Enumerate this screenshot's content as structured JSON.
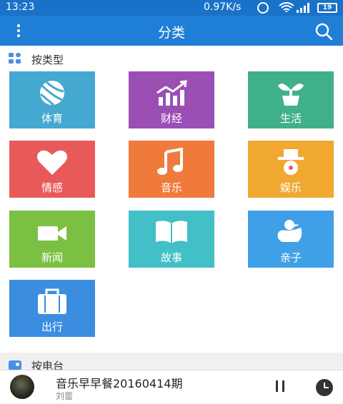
{
  "status_bar": {
    "time": "13:23",
    "net_speed": "0.97K/s",
    "battery": "19"
  },
  "app_bar": {
    "title": "分类",
    "menu_icon": "more-vertical-icon",
    "search_icon": "search-icon"
  },
  "by_type": {
    "label": "按类型",
    "categories": [
      {
        "label": "体育",
        "icon": "basketball-icon",
        "color": "#45a8d0"
      },
      {
        "label": "财经",
        "icon": "chart-up-icon",
        "color": "#9b4fb5"
      },
      {
        "label": "生活",
        "icon": "sprout-icon",
        "color": "#3fb08a"
      },
      {
        "label": "情感",
        "icon": "heart-icon",
        "color": "#e85a5a"
      },
      {
        "label": "音乐",
        "icon": "music-note-icon",
        "color": "#ef7a3c"
      },
      {
        "label": "娱乐",
        "icon": "face-hat-icon",
        "color": "#f0a830"
      },
      {
        "label": "新闻",
        "icon": "video-camera-icon",
        "color": "#7bc043"
      },
      {
        "label": "故事",
        "icon": "open-book-icon",
        "color": "#43bfc7"
      },
      {
        "label": "亲子",
        "icon": "duck-icon",
        "color": "#3fa0e8"
      },
      {
        "label": "出行",
        "icon": "luggage-icon",
        "color": "#3b8de0"
      }
    ]
  },
  "by_station": {
    "label": "按电台"
  },
  "player": {
    "song": "音乐早早餐20160414期",
    "artist": "刘蕾"
  }
}
